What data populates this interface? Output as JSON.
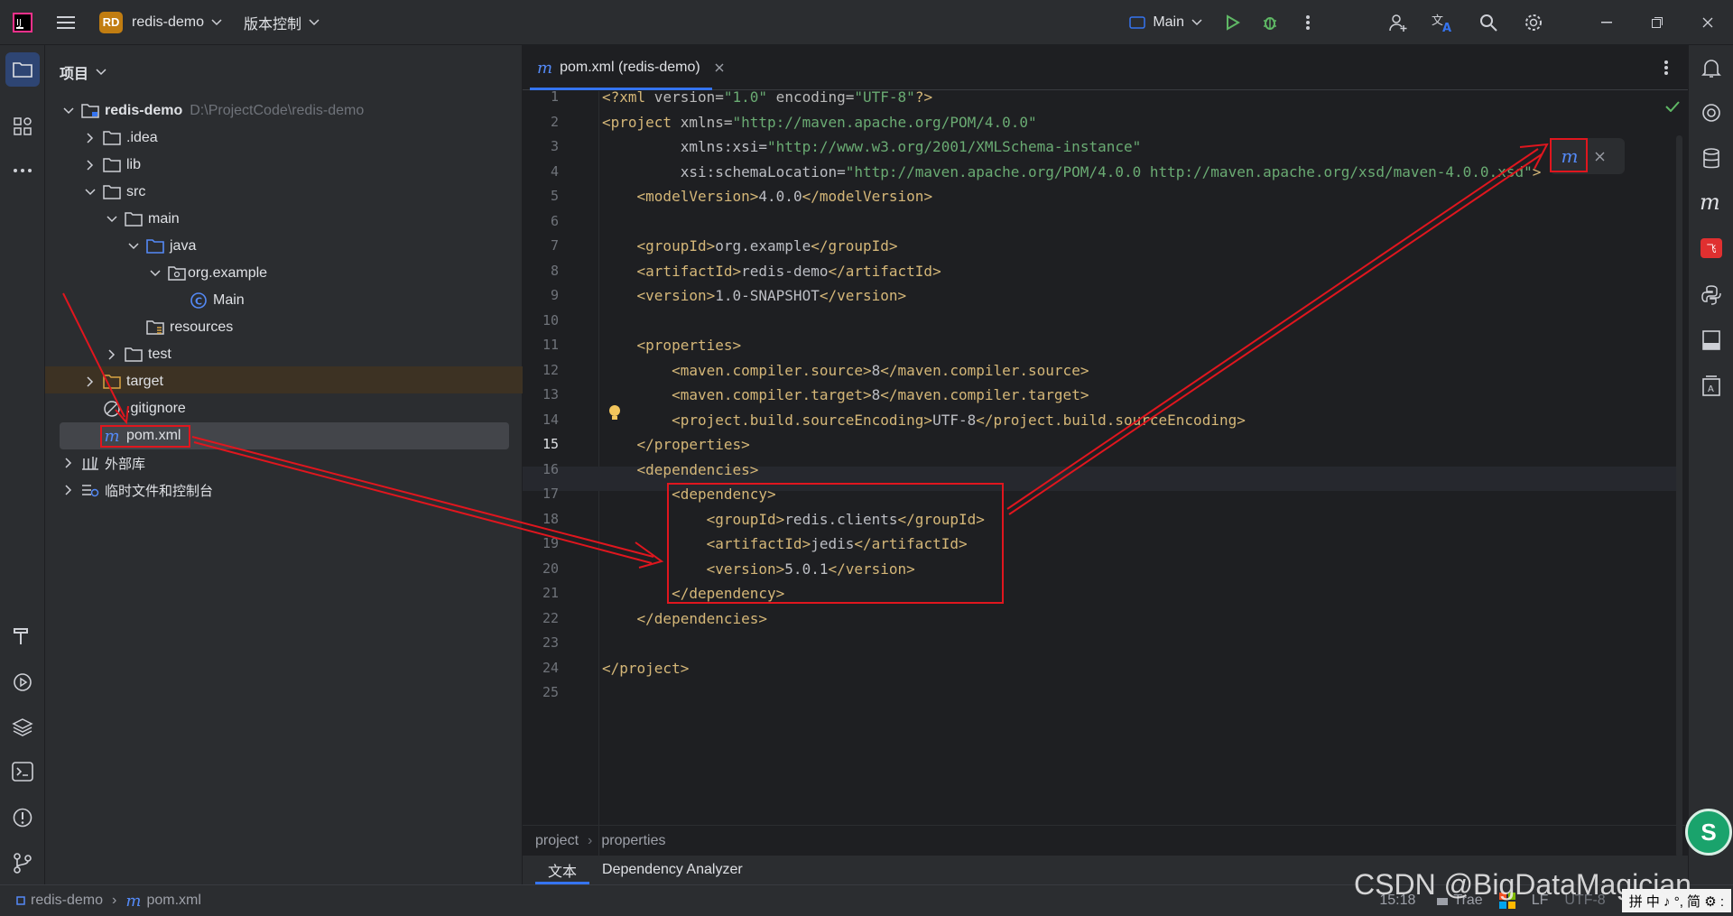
{
  "titlebar": {
    "project_badge": "RD",
    "project_name": "redis-demo",
    "vcs_label": "版本控制",
    "run_config": "Main"
  },
  "project_panel": {
    "title": "项目",
    "tree": [
      {
        "label": "redis-demo",
        "path": "D:\\ProjectCode\\redis-demo"
      },
      {
        "label": ".idea"
      },
      {
        "label": "lib"
      },
      {
        "label": "src"
      },
      {
        "label": "main"
      },
      {
        "label": "java"
      },
      {
        "label": "org.example"
      },
      {
        "label": "Main"
      },
      {
        "label": "resources"
      },
      {
        "label": "test"
      },
      {
        "label": "target"
      },
      {
        "label": ".gitignore"
      },
      {
        "label": "pom.xml"
      },
      {
        "label": "外部库"
      },
      {
        "label": "临时文件和控制台"
      }
    ]
  },
  "editor": {
    "tab_label": "pom.xml (redis-demo)",
    "breadcrumb": [
      "project",
      "properties"
    ],
    "bottom_tabs": [
      "文本",
      "Dependency Analyzer"
    ],
    "lines": [
      "<?xml version=\"1.0\" encoding=\"UTF-8\"?>",
      "<project xmlns=\"http://maven.apache.org/POM/4.0.0\"",
      "         xmlns:xsi=\"http://www.w3.org/2001/XMLSchema-instance\"",
      "         xsi:schemaLocation=\"http://maven.apache.org/POM/4.0.0 http://maven.apache.org/xsd/maven-4.0.0.xsd\">",
      "    <modelVersion>4.0.0</modelVersion>",
      "",
      "    <groupId>org.example</groupId>",
      "    <artifactId>redis-demo</artifactId>",
      "    <version>1.0-SNAPSHOT</version>",
      "",
      "    <properties>",
      "        <maven.compiler.source>8</maven.compiler.source>",
      "        <maven.compiler.target>8</maven.compiler.target>",
      "        <project.build.sourceEncoding>UTF-8</project.build.sourceEncoding>",
      "    </properties>",
      "    <dependencies>",
      "        <dependency>",
      "            <groupId>redis.clients</groupId>",
      "            <artifactId>jedis</artifactId>",
      "            <version>5.0.1</version>",
      "        </dependency>",
      "    </dependencies>",
      "",
      "</project>",
      ""
    ],
    "current_line": 15
  },
  "statusbar": {
    "crumb_project": "redis-demo",
    "crumb_file": "pom.xml",
    "position": "15:18",
    "plugin": "Trae",
    "line_sep": "LF",
    "encoding": "UTF-8",
    "ime": "拼 中 ♪ °, 简 ⚙ :"
  },
  "watermark": "CSDN @BigDataMagician",
  "colors": {
    "accent": "#3574f0",
    "annotation": "#e0161e",
    "background": "#1e1f22"
  }
}
